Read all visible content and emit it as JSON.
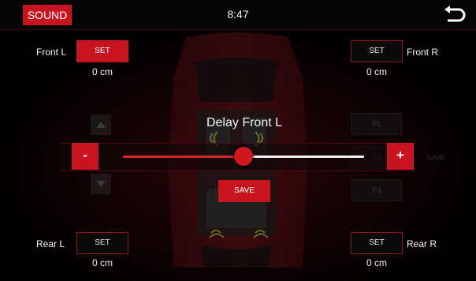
{
  "header": {
    "mode_label": "SOUND",
    "time": "8:47"
  },
  "channels": {
    "front_left": {
      "label": "Front L",
      "button": "SET",
      "value": "0 cm"
    },
    "front_right": {
      "label": "Front R",
      "button": "SET",
      "value": "0 cm"
    },
    "rear_left": {
      "label": "Rear L",
      "button": "SET",
      "value": "0 cm"
    },
    "rear_right": {
      "label": "Rear R",
      "button": "SET",
      "value": "0 cm"
    }
  },
  "delay": {
    "title": "Delay Front L",
    "minus_label": "-",
    "plus_label": "+",
    "save_label": "SAVE",
    "level": 0.5
  },
  "presets": {
    "items": [
      "P1",
      "P2",
      "P3"
    ],
    "save_label": "SAVE"
  },
  "colors": {
    "accent": "#c8141f",
    "background": "#000000"
  }
}
